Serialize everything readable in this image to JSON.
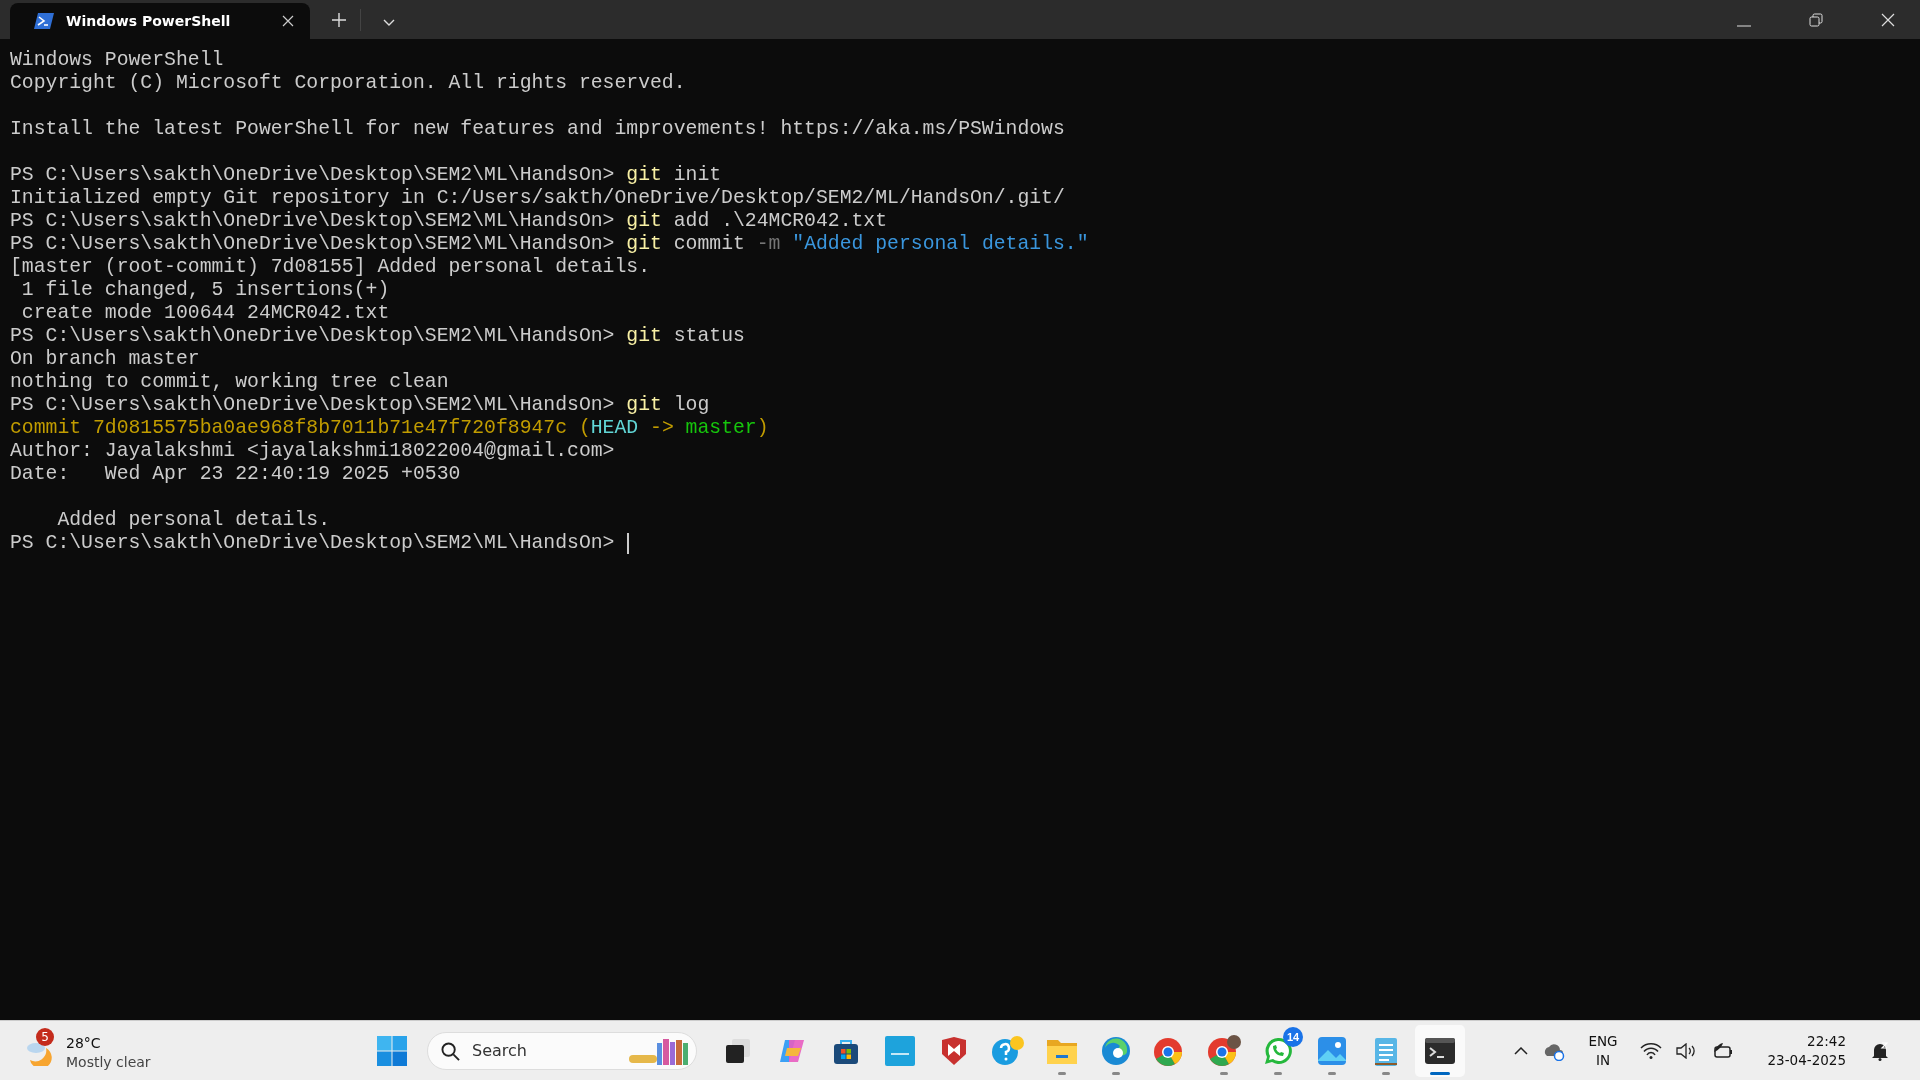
{
  "tab": {
    "title": "Windows PowerShell"
  },
  "terminal": {
    "cursor": true,
    "lines": [
      {
        "kind": "text",
        "segments": [
          {
            "kind": "plain",
            "text": "Windows PowerShell"
          }
        ]
      },
      {
        "kind": "text",
        "segments": [
          {
            "kind": "plain",
            "text": "Copyright (C) Microsoft Corporation. All rights reserved."
          }
        ]
      },
      {
        "kind": "blank"
      },
      {
        "kind": "text",
        "segments": [
          {
            "kind": "plain",
            "text": "Install the latest PowerShell for new features and improvements! https://aka.ms/PSWindows"
          }
        ]
      },
      {
        "kind": "blank"
      },
      {
        "kind": "text",
        "segments": [
          {
            "kind": "plain",
            "text": "PS C:\\Users\\sakth\\OneDrive\\Desktop\\SEM2\\ML\\HandsOn> "
          },
          {
            "kind": "command",
            "text": "git"
          },
          {
            "kind": "plain",
            "text": " init"
          }
        ]
      },
      {
        "kind": "text",
        "segments": [
          {
            "kind": "plain",
            "text": "Initialized empty Git repository in C:/Users/sakth/OneDrive/Desktop/SEM2/ML/HandsOn/.git/"
          }
        ]
      },
      {
        "kind": "text",
        "segments": [
          {
            "kind": "plain",
            "text": "PS C:\\Users\\sakth\\OneDrive\\Desktop\\SEM2\\ML\\HandsOn> "
          },
          {
            "kind": "command",
            "text": "git"
          },
          {
            "kind": "plain",
            "text": " add .\\24MCR042.txt"
          }
        ]
      },
      {
        "kind": "text",
        "segments": [
          {
            "kind": "plain",
            "text": "PS C:\\Users\\sakth\\OneDrive\\Desktop\\SEM2\\ML\\HandsOn> "
          },
          {
            "kind": "command",
            "text": "git"
          },
          {
            "kind": "plain",
            "text": " commit "
          },
          {
            "kind": "flag",
            "text": "-m"
          },
          {
            "kind": "string",
            "text": " \"Added personal details.\""
          }
        ]
      },
      {
        "kind": "text",
        "segments": [
          {
            "kind": "plain",
            "text": "[master (root-commit) 7d08155] Added personal details."
          }
        ]
      },
      {
        "kind": "text",
        "segments": [
          {
            "kind": "plain",
            "text": " 1 file changed, 5 insertions(+)"
          }
        ]
      },
      {
        "kind": "text",
        "segments": [
          {
            "kind": "plain",
            "text": " create mode 100644 24MCR042.txt"
          }
        ]
      },
      {
        "kind": "text",
        "segments": [
          {
            "kind": "plain",
            "text": "PS C:\\Users\\sakth\\OneDrive\\Desktop\\SEM2\\ML\\HandsOn> "
          },
          {
            "kind": "command",
            "text": "git"
          },
          {
            "kind": "plain",
            "text": " status"
          }
        ]
      },
      {
        "kind": "text",
        "segments": [
          {
            "kind": "plain",
            "text": "On branch master"
          }
        ]
      },
      {
        "kind": "text",
        "segments": [
          {
            "kind": "plain",
            "text": "nothing to commit, working tree clean"
          }
        ]
      },
      {
        "kind": "text",
        "segments": [
          {
            "kind": "plain",
            "text": "PS C:\\Users\\sakth\\OneDrive\\Desktop\\SEM2\\ML\\HandsOn> "
          },
          {
            "kind": "command",
            "text": "git"
          },
          {
            "kind": "plain",
            "text": " log"
          }
        ]
      },
      {
        "kind": "text",
        "segments": [
          {
            "kind": "hash",
            "text": "commit 7d0815575ba0ae968f8b7011b71e47f720f8947c ("
          },
          {
            "kind": "head",
            "text": "HEAD"
          },
          {
            "kind": "hash",
            "text": " -> "
          },
          {
            "kind": "branch",
            "text": "master"
          },
          {
            "kind": "hash",
            "text": ")"
          }
        ]
      },
      {
        "kind": "text",
        "segments": [
          {
            "kind": "plain",
            "text": "Author: Jayalakshmi <jayalakshmi18022004@gmail.com>"
          }
        ]
      },
      {
        "kind": "text",
        "segments": [
          {
            "kind": "plain",
            "text": "Date:   Wed Apr 23 22:40:19 2025 +0530"
          }
        ]
      },
      {
        "kind": "blank"
      },
      {
        "kind": "text",
        "segments": [
          {
            "kind": "plain",
            "text": "    Added personal details."
          }
        ]
      },
      {
        "kind": "text",
        "segments": [
          {
            "kind": "plain",
            "text": "PS C:\\Users\\sakth\\OneDrive\\Desktop\\SEM2\\ML\\HandsOn> "
          }
        ]
      }
    ]
  },
  "taskbar": {
    "weather": {
      "badge": "5",
      "temperature": "28°C",
      "condition": "Mostly clear"
    },
    "search": {
      "placeholder": "Search"
    },
    "apps": [
      {
        "kind": "taskview",
        "running": false,
        "active": false
      },
      {
        "kind": "copilot",
        "running": false,
        "active": false
      },
      {
        "kind": "store",
        "running": false,
        "active": false
      },
      {
        "kind": "myhp",
        "running": false,
        "active": false
      },
      {
        "kind": "shield",
        "running": false,
        "active": false
      },
      {
        "kind": "help",
        "running": false,
        "active": false
      },
      {
        "kind": "folder",
        "running": true,
        "active": false
      },
      {
        "kind": "edge",
        "running": true,
        "active": false
      },
      {
        "kind": "chrome",
        "running": false,
        "active": false
      },
      {
        "kind": "chrome_profile",
        "running": true,
        "active": false
      },
      {
        "kind": "chat",
        "running": true,
        "active": false,
        "badge": "14"
      },
      {
        "kind": "photos",
        "running": true,
        "active": false
      },
      {
        "kind": "notepad",
        "running": true,
        "active": false
      },
      {
        "kind": "terminal",
        "running": true,
        "active": true
      }
    ],
    "tray": {
      "language": "ENG",
      "region": "IN",
      "time": "22:42",
      "date": "23-04-2025"
    }
  }
}
